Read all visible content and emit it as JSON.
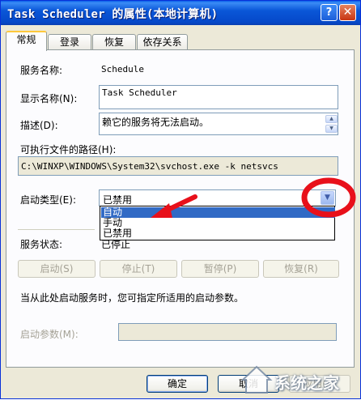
{
  "window": {
    "title": "Task Scheduler 的属性(本地计算机)",
    "help_label": "?",
    "close_label": "✕"
  },
  "tabs": [
    {
      "label": "常规",
      "active": true
    },
    {
      "label": "登录",
      "active": false
    },
    {
      "label": "恢复",
      "active": false
    },
    {
      "label": "依存关系",
      "active": false
    }
  ],
  "general": {
    "service_name_label": "服务名称:",
    "service_name_value": "Schedule",
    "display_name_label": "显示名称(N):",
    "display_name_value": "Task Scheduler",
    "description_label": "描述(D):",
    "description_value": "赖它的服务将无法启动。",
    "exe_path_label": "可执行文件的路径(H):",
    "exe_path_value": "C:\\WINXP\\WINDOWS\\System32\\svchost.exe -k netsvcs",
    "startup_type_label": "启动类型(E):",
    "startup_type_value": "已禁用",
    "startup_options": [
      "自动",
      "手动",
      "已禁用"
    ],
    "highlighted_option": "自动",
    "service_status_label": "服务状态:",
    "service_status_value": "已停止",
    "hint_text": "当从此处启动服务时，您可指定所适用的启动参数。",
    "start_params_label": "启动参数(M):",
    "start_params_value": ""
  },
  "buttons": {
    "start": "启动(S)",
    "stop": "停止(T)",
    "pause": "暂停(P)",
    "resume": "恢复(R)",
    "ok": "确定",
    "cancel": "取消",
    "apply": "应用(A)"
  },
  "annotation": {
    "watermark": "系统之家",
    "circle_color": "#E8101A",
    "arrow_color": "#E8101A"
  }
}
